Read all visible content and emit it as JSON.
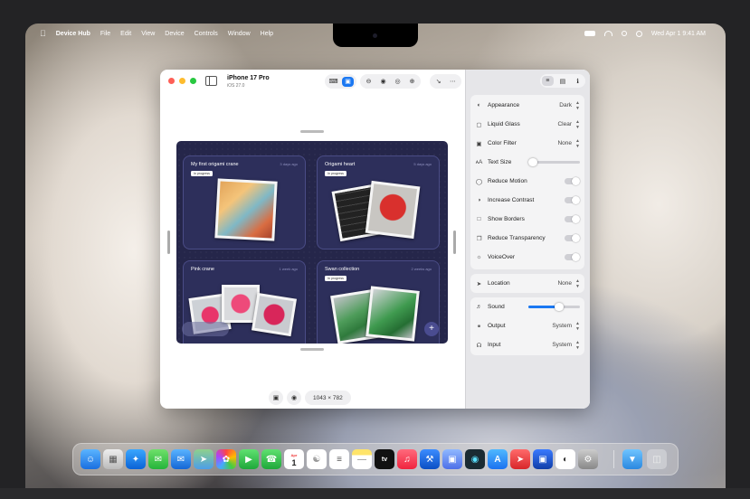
{
  "menubar": {
    "app_name": "Device Hub",
    "items": [
      "File",
      "Edit",
      "View",
      "Device",
      "Controls",
      "Window",
      "Help"
    ],
    "datetime": "Wed Apr 1  9:41 AM"
  },
  "window": {
    "device_name": "iPhone 17 Pro",
    "os_version": "iOS 27.0",
    "dimensions": "1043 × 782"
  },
  "preview": {
    "cards": [
      {
        "title": "My first origami crane",
        "time": "3 days ago",
        "badge": "In progress"
      },
      {
        "title": "Origami heart",
        "time": "5 days ago",
        "badge": "In progress"
      },
      {
        "title": "Pink crane",
        "time": "1 week ago",
        "badge": "In progress"
      },
      {
        "title": "Swan collection",
        "time": "2 weeks ago",
        "badge": "In progress"
      }
    ]
  },
  "inspector": {
    "appearance": {
      "label": "Appearance",
      "value": "Dark"
    },
    "liquid_glass": {
      "label": "Liquid Glass",
      "value": "Clear"
    },
    "color_filter": {
      "label": "Color Filter",
      "value": "None"
    },
    "text_size": {
      "label": "Text Size",
      "level": 0.05
    },
    "reduce_motion": {
      "label": "Reduce Motion",
      "on": false
    },
    "increase_contrast": {
      "label": "Increase Contrast",
      "on": false
    },
    "show_borders": {
      "label": "Show Borders",
      "on": false
    },
    "reduce_transparency": {
      "label": "Reduce Transparency",
      "on": false
    },
    "voiceover": {
      "label": "VoiceOver",
      "on": false
    },
    "location": {
      "label": "Location",
      "value": "None"
    },
    "sound": {
      "label": "Sound",
      "level": 0.6
    },
    "output": {
      "label": "Output",
      "value": "System"
    },
    "input": {
      "label": "Input",
      "value": "System"
    }
  },
  "dock": {
    "calendar_month": "Apr",
    "calendar_day": "1",
    "tv_label": "tv"
  },
  "colors": {
    "accent": "#1b78f2",
    "close": "#fe5f57",
    "minimize": "#febc2e",
    "zoom": "#28c840",
    "preview_bg": "#25264a"
  }
}
